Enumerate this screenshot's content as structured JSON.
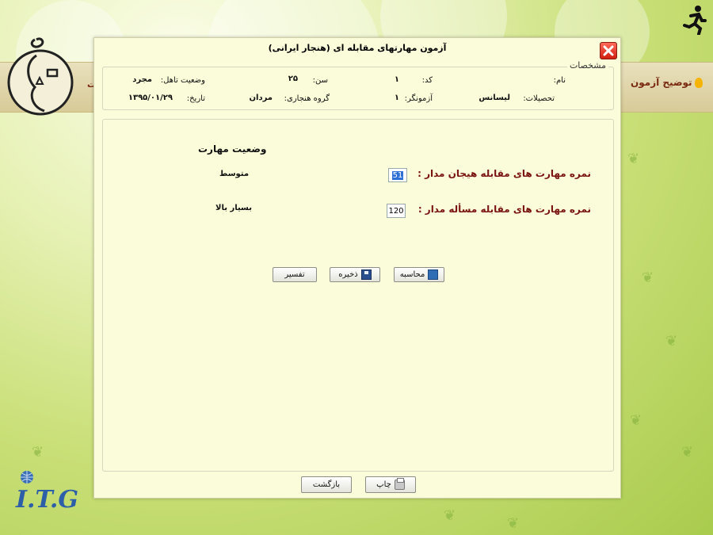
{
  "app": {
    "explain_link": "توضیح آزمون",
    "left_mark": "ت",
    "itg_logo": "I.T.G"
  },
  "dialog": {
    "title": "آزمون مهارتهای مقابله ای (هنجار ایرانی)",
    "close_icon": "close-icon",
    "info": {
      "legend": "مشخصات",
      "name_label": "نام:",
      "name_value": "",
      "code_label": "کد:",
      "code_value": "۱",
      "age_label": "سن:",
      "age_value": "۲۵",
      "marital_label": "وضعیت تاهل:",
      "marital_value": "مجرد",
      "education_label": "تحصیلات:",
      "education_value": "لیسانس",
      "examiner_label": "آزمونگر:",
      "examiner_value": "۱",
      "norm_group_label": "گروه هنجاری:",
      "norm_group_value": "مردان",
      "date_label": "تاریخ:",
      "date_value": "۱۳۹۵/۰۱/۲۹"
    },
    "skills": {
      "heading": "وضعیت مهارت",
      "emotion_label": "نمره مهارت های مقابله هیجان مدار :",
      "emotion_score": "51",
      "emotion_status": "متوسط",
      "problem_label": "نمره مهارت های مقابله مسأله مدار :",
      "problem_score": "120",
      "problem_status": "بسیار بالا"
    },
    "buttons": {
      "calculate": "محاسبه",
      "save": "ذخیره",
      "interpret": "تفسیر",
      "print": "چاپ",
      "back": "بازگشت"
    }
  },
  "colors": {
    "dialog_bg": "#fbfcd9",
    "label_accent": "#7a1410",
    "close_red": "#d01e0e"
  }
}
